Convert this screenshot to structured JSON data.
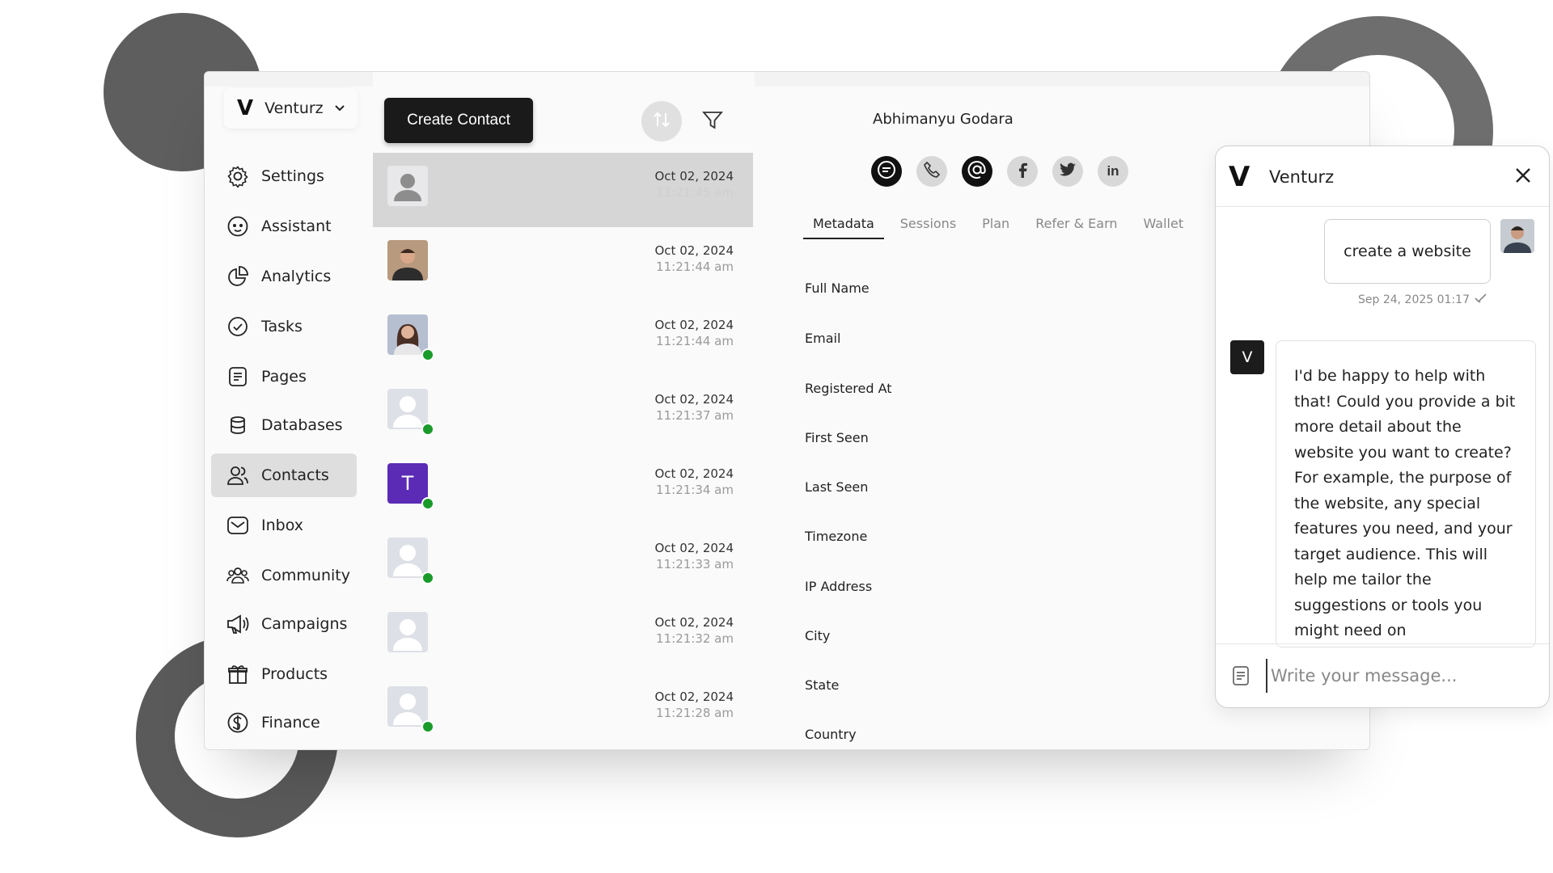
{
  "brand": {
    "name": "Venturz",
    "logo": "V"
  },
  "nav": [
    {
      "label": "Settings",
      "icon": "gear-icon"
    },
    {
      "label": "Assistant",
      "icon": "assistant-face-icon"
    },
    {
      "label": "Analytics",
      "icon": "pie-chart-icon"
    },
    {
      "label": "Tasks",
      "icon": "check-circle-icon"
    },
    {
      "label": "Pages",
      "icon": "document-icon"
    },
    {
      "label": "Databases",
      "icon": "database-icon"
    },
    {
      "label": "Contacts",
      "icon": "users-icon",
      "active": true
    },
    {
      "label": "Inbox",
      "icon": "inbox-icon"
    },
    {
      "label": "Community",
      "icon": "community-icon"
    },
    {
      "label": "Campaigns",
      "icon": "megaphone-icon"
    },
    {
      "label": "Products",
      "icon": "gift-box-icon"
    },
    {
      "label": "Finance",
      "icon": "dollar-circle-icon"
    }
  ],
  "list": {
    "create_label": "Create Contact",
    "rows": [
      {
        "date": "Oct 02, 2024",
        "time": "11:21:45 am",
        "avatar": "default"
      },
      {
        "date": "Oct 02, 2024",
        "time": "11:21:44 am",
        "avatar": "photo-man"
      },
      {
        "date": "Oct 02, 2024",
        "time": "11:21:44 am",
        "avatar": "photo-woman",
        "online": true
      },
      {
        "date": "Oct 02, 2024",
        "time": "11:21:37 am",
        "avatar": "generic",
        "online": true
      },
      {
        "date": "Oct 02, 2024",
        "time": "11:21:34 am",
        "avatar": "letter",
        "letter": "T",
        "online": true
      },
      {
        "date": "Oct 02, 2024",
        "time": "11:21:33 am",
        "avatar": "generic",
        "online": true
      },
      {
        "date": "Oct 02, 2024",
        "time": "11:21:32 am",
        "avatar": "generic"
      },
      {
        "date": "Oct 02, 2024",
        "time": "11:21:28 am",
        "avatar": "generic",
        "online": true
      }
    ]
  },
  "detail": {
    "name": "Abhimanyu Godara",
    "tabs": [
      "Metadata",
      "Sessions",
      "Plan",
      "Refer & Earn",
      "Wallet"
    ],
    "fields": [
      "Full Name",
      "Email",
      "Registered At",
      "First Seen",
      "Last Seen",
      "Timezone",
      "IP Address",
      "City",
      "State",
      "Country"
    ]
  },
  "chat": {
    "title": "Venturz",
    "logo": "V",
    "user_message": "create a website",
    "user_time": "Sep 24, 2025 01:17",
    "bot_letter": "V",
    "bot_message": "I'd be happy to help with that! Could you provide a bit more detail about the website you want to create? For example, the purpose of the website, any special features you need, and your target audience. This will help me tailor the suggestions or tools you might need on",
    "input_placeholder": "Write your message..."
  }
}
